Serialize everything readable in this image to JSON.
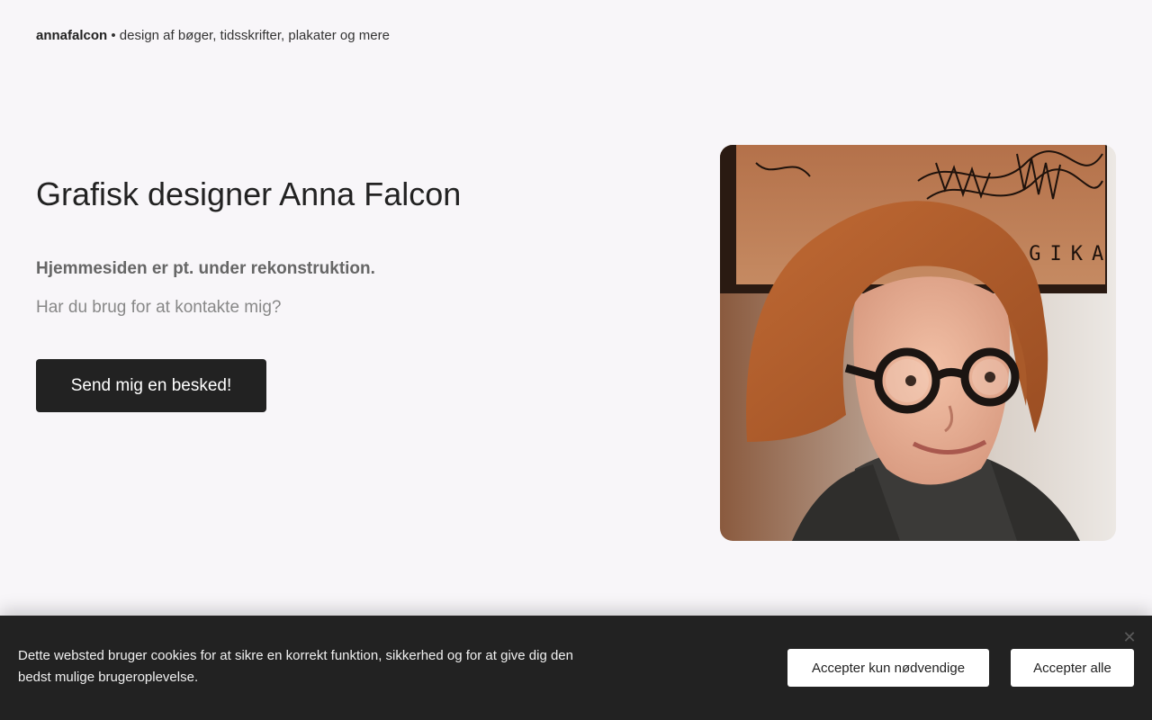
{
  "header": {
    "brand_name": "annafalcon",
    "separator": "•",
    "tagline": "design af bøger, tidsskrifter, plakater og mere"
  },
  "hero": {
    "title": "Grafisk designer Anna Falcon",
    "lead": "Hjemmesiden er pt. under rekonstruktion.",
    "sub": "Har du brug for at kontakte mig?",
    "cta_label": "Send mig en besked!",
    "portrait_sign_text": "AGIKA"
  },
  "cookie_banner": {
    "text": "Dette websted bruger cookies for at sikre en korrekt funktion, sikkerhed og for at give dig den bedst mulige brugeroplevelse.",
    "accept_necessary_label": "Accepter kun nødvendige",
    "accept_all_label": "Accepter alle",
    "close_icon": "close-icon"
  },
  "colors": {
    "page_background": "#f8f6f9",
    "button_dark": "#222222",
    "cookie_background": "#222222"
  }
}
